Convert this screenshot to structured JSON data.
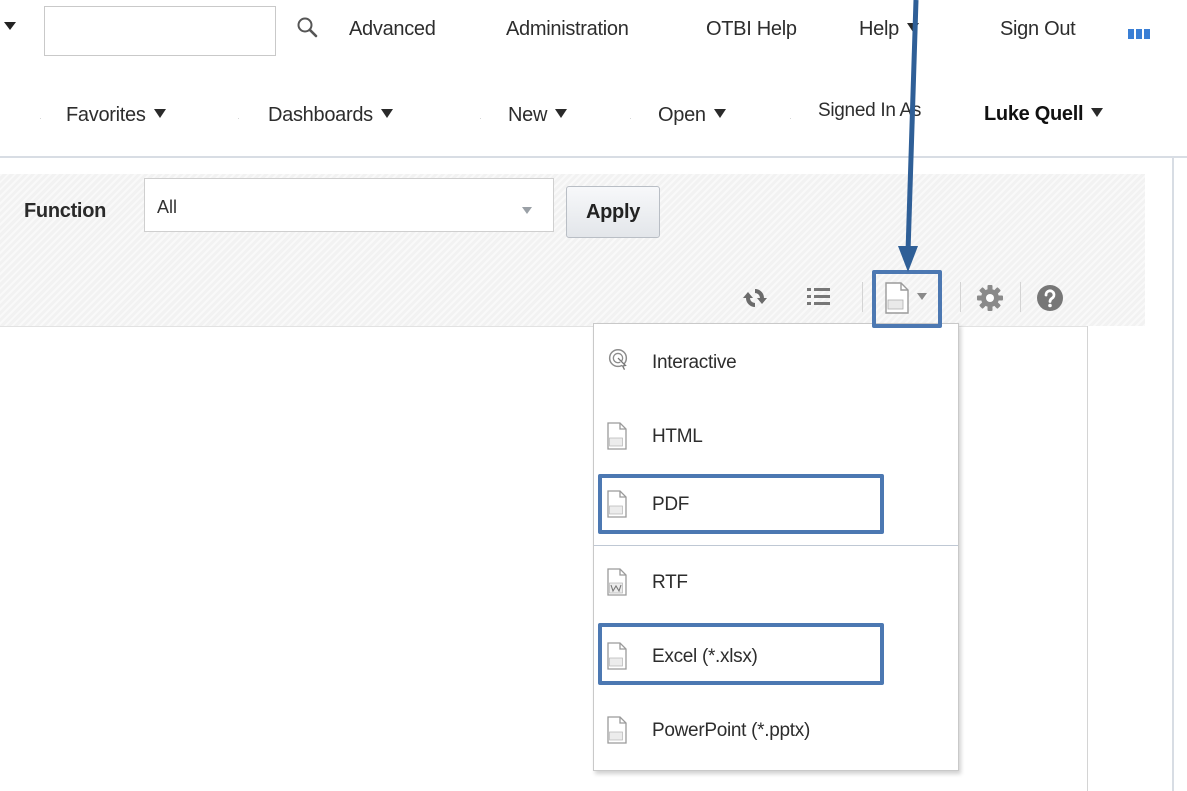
{
  "header": {
    "search_placeholder": "",
    "links": [
      "Advanced",
      "Administration",
      "OTBI Help",
      "Help",
      "Sign Out"
    ]
  },
  "nav": {
    "items": [
      "Favorites",
      "Dashboards",
      "New",
      "Open"
    ],
    "signed_in_label": "Signed In As",
    "user_name": "Luke Quell"
  },
  "filters": {
    "function_label": "Function",
    "function_value": "All",
    "apply_label": "Apply"
  },
  "toolbar": {
    "icons": [
      "refresh-icon",
      "list-icon",
      "export-icon",
      "gear-icon",
      "help-icon"
    ]
  },
  "export_menu": {
    "items": [
      "Interactive",
      "HTML",
      "PDF",
      "RTF",
      "Excel (*.xlsx)",
      "PowerPoint (*.pptx)"
    ],
    "highlighted": [
      "PDF",
      "Excel (*.xlsx)"
    ]
  },
  "colors": {
    "callout": "#4c78b2",
    "apps_icon": "#3a7fd5"
  }
}
